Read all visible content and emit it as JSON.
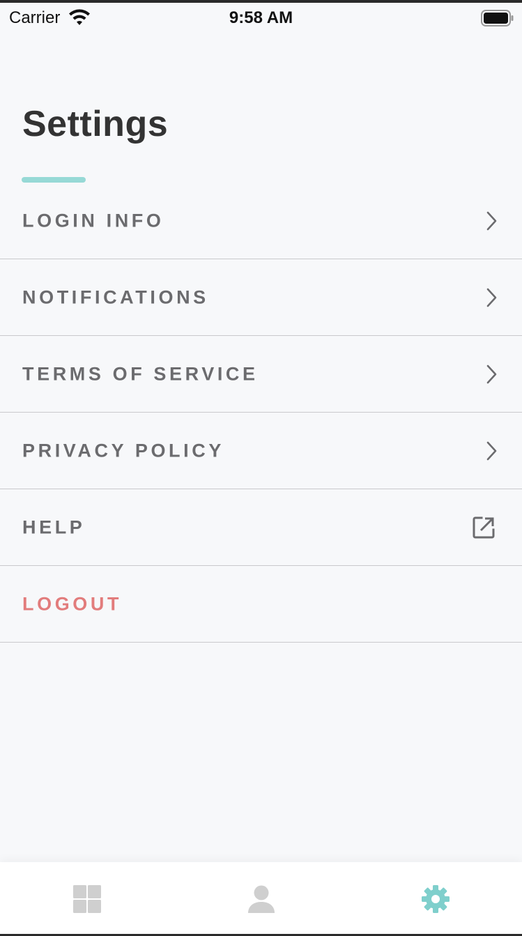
{
  "status_bar": {
    "carrier": "Carrier",
    "time": "9:58 AM",
    "wifi_icon": "wifi-icon",
    "battery_icon": "battery-full-icon"
  },
  "page": {
    "title": "Settings",
    "accent_color": "#97d9d6"
  },
  "menu": {
    "items": [
      {
        "label": "LOGIN INFO",
        "icon": "chevron-right-icon"
      },
      {
        "label": "NOTIFICATIONS",
        "icon": "chevron-right-icon"
      },
      {
        "label": "TERMS OF SERVICE",
        "icon": "chevron-right-icon"
      },
      {
        "label": "PRIVACY POLICY",
        "icon": "chevron-right-icon"
      },
      {
        "label": "HELP",
        "icon": "external-link-icon"
      },
      {
        "label": "LOGOUT",
        "icon": "",
        "color": "#e27c7c"
      }
    ]
  },
  "tab_bar": {
    "tabs": [
      {
        "icon": "dashboard-grid-icon",
        "active": false,
        "color": "#cfcfcf"
      },
      {
        "icon": "user-icon",
        "active": false,
        "color": "#cfcfcf"
      },
      {
        "icon": "gear-icon",
        "active": true,
        "color": "#7fcfcc"
      }
    ]
  }
}
